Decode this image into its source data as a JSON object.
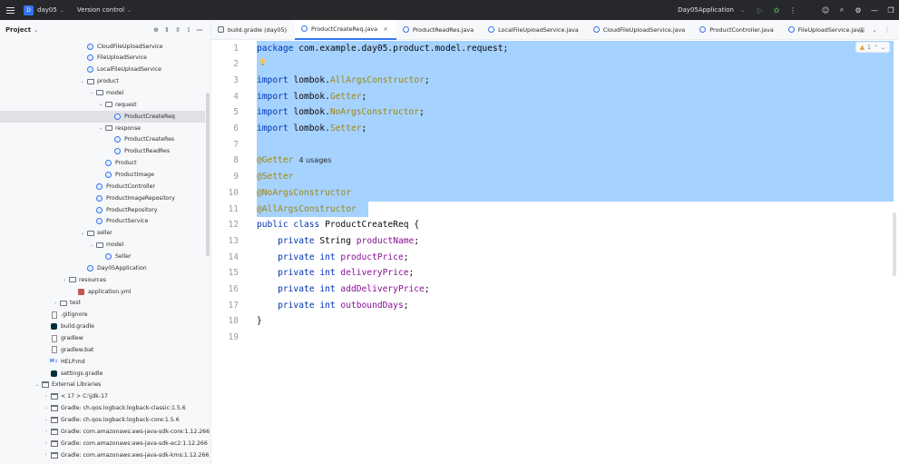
{
  "titlebar": {
    "project_badge": "D",
    "project_name": "day05",
    "version_control": "Version control",
    "run_config": "Day05Application"
  },
  "project_panel": {
    "title": "Project",
    "tree": [
      {
        "label": "CloudFileUploadService",
        "indent": 0,
        "icon": "class-icon"
      },
      {
        "label": "FileUploadService",
        "indent": 0,
        "icon": "class-icon"
      },
      {
        "label": "LocalFileUploadService",
        "indent": 0,
        "icon": "class-icon"
      },
      {
        "label": "product",
        "indent": 0,
        "icon": "folder-icon",
        "arrow": "v"
      },
      {
        "label": "model",
        "indent": 1,
        "icon": "folder-icon",
        "arrow": "v"
      },
      {
        "label": "request",
        "indent": 2,
        "icon": "folder-icon",
        "arrow": "v"
      },
      {
        "label": "ProductCreateReq",
        "indent": 3,
        "icon": "class-icon",
        "selected": true
      },
      {
        "label": "response",
        "indent": 2,
        "icon": "folder-icon",
        "arrow": "v"
      },
      {
        "label": "ProductCreateRes",
        "indent": 3,
        "icon": "class-icon"
      },
      {
        "label": "ProductReadRes",
        "indent": 3,
        "icon": "class-icon"
      },
      {
        "label": "Product",
        "indent": 2,
        "icon": "class-icon"
      },
      {
        "label": "ProductImage",
        "indent": 2,
        "icon": "class-icon"
      },
      {
        "label": "ProductController",
        "indent": 1,
        "icon": "class-icon"
      },
      {
        "label": "ProductImageRepository",
        "indent": 1,
        "icon": "class-icon"
      },
      {
        "label": "ProductRepository",
        "indent": 1,
        "icon": "class-icon"
      },
      {
        "label": "ProductService",
        "indent": 1,
        "icon": "class-icon"
      },
      {
        "label": "seller",
        "indent": 0,
        "icon": "folder-icon",
        "arrow": "v"
      },
      {
        "label": "model",
        "indent": 1,
        "icon": "folder-icon",
        "arrow": "v"
      },
      {
        "label": "Seller",
        "indent": 2,
        "icon": "class-icon"
      },
      {
        "label": "Day05Application",
        "indent": 0,
        "icon": "class-icon"
      },
      {
        "label": "resources",
        "indent": -2,
        "icon": "folder-icon",
        "arrow": "v"
      },
      {
        "label": "application.yml",
        "indent": -1,
        "icon": "yml-icon"
      },
      {
        "label": "test",
        "indent": -3,
        "icon": "folder-icon",
        "arrow": ">"
      },
      {
        "label": ".gitignore",
        "indent": -4,
        "icon": "file-icon"
      },
      {
        "label": "build.gradle",
        "indent": -4,
        "icon": "gradle-icon"
      },
      {
        "label": "gradlew",
        "indent": -4,
        "icon": "file-icon"
      },
      {
        "label": "gradlew.bat",
        "indent": -4,
        "icon": "file-icon"
      },
      {
        "label": "HELP.md",
        "indent": -4,
        "icon": "md-icon"
      },
      {
        "label": "settings.gradle",
        "indent": -4,
        "icon": "gradle-icon"
      },
      {
        "label": "External Libraries",
        "indent": -5,
        "icon": "library-icon",
        "arrow": "v"
      },
      {
        "label": "< 17 >  C:\\jdk-17",
        "indent": -4,
        "icon": "library-icon",
        "arrow": ">"
      },
      {
        "label": "Gradle: ch.qos.logback:logback-classic:1.5.6",
        "indent": -4,
        "icon": "library-icon",
        "arrow": ">"
      },
      {
        "label": "Gradle: ch.qos.logback:logback-core:1.5.6",
        "indent": -4,
        "icon": "library-icon",
        "arrow": ">"
      },
      {
        "label": "Gradle: com.amazonaws:aws-java-sdk-core:1.12.266",
        "indent": -4,
        "icon": "library-icon",
        "arrow": ">"
      },
      {
        "label": "Gradle: com.amazonaws:aws-java-sdk-ec2:1.12.266",
        "indent": -4,
        "icon": "library-icon",
        "arrow": ">"
      },
      {
        "label": "Gradle: com.amazonaws:aws-java-sdk-kms:1.12.266",
        "indent": -4,
        "icon": "library-icon",
        "arrow": ">"
      }
    ]
  },
  "tabs": [
    {
      "label": "build.gradle (day05)",
      "icon": "gradle"
    },
    {
      "label": "ProductCreateReq.java",
      "active": true,
      "close": "×"
    },
    {
      "label": "ProductReadRes.java"
    },
    {
      "label": "LocalFileUploadService.java"
    },
    {
      "label": "CloudFileUploadService.java"
    },
    {
      "label": "ProductController.java"
    },
    {
      "label": "FileUploadService.java"
    }
  ],
  "editor": {
    "inspection_count": "1",
    "lines": [
      {
        "n": "1",
        "parts": [
          [
            "kw",
            "package "
          ],
          [
            "",
            "com.example.day05.product.model.request;"
          ]
        ]
      },
      {
        "n": "2",
        "parts": []
      },
      {
        "n": "3",
        "parts": [
          [
            "kw",
            "import "
          ],
          [
            "",
            "lombok."
          ],
          [
            "ann",
            "AllArgsConstructor"
          ],
          [
            "",
            ";"
          ]
        ]
      },
      {
        "n": "4",
        "parts": [
          [
            "kw",
            "import "
          ],
          [
            "",
            "lombok."
          ],
          [
            "ann",
            "Getter"
          ],
          [
            "",
            ";"
          ]
        ]
      },
      {
        "n": "5",
        "parts": [
          [
            "kw",
            "import "
          ],
          [
            "",
            "lombok."
          ],
          [
            "ann",
            "NoArgsConstructor"
          ],
          [
            "",
            ";"
          ]
        ]
      },
      {
        "n": "6",
        "parts": [
          [
            "kw",
            "import "
          ],
          [
            "",
            "lombok."
          ],
          [
            "ann",
            "Setter"
          ],
          [
            "",
            ";"
          ]
        ]
      },
      {
        "n": "7",
        "parts": []
      },
      {
        "n": "8",
        "parts": [
          [
            "ann",
            "@Getter"
          ]
        ],
        "usage": "4 usages"
      },
      {
        "n": "9",
        "parts": [
          [
            "ann",
            "@Setter"
          ]
        ]
      },
      {
        "n": "10",
        "parts": [
          [
            "ann",
            "@NoArgsConstructor"
          ]
        ]
      },
      {
        "n": "11",
        "parts": [
          [
            "ann",
            "@AllArgsConstructor"
          ]
        ]
      },
      {
        "n": "12",
        "parts": [
          [
            "kw",
            "public class "
          ],
          [
            "",
            "ProductCreateReq {"
          ]
        ]
      },
      {
        "n": "13",
        "parts": [
          [
            "",
            "    "
          ],
          [
            "kw",
            "private "
          ],
          [
            "",
            "String "
          ],
          [
            "fld",
            "productName"
          ],
          [
            "",
            ";"
          ]
        ]
      },
      {
        "n": "14",
        "parts": [
          [
            "",
            "    "
          ],
          [
            "kw",
            "private int "
          ],
          [
            "fld",
            "productPrice"
          ],
          [
            "",
            ";"
          ]
        ]
      },
      {
        "n": "15",
        "parts": [
          [
            "",
            "    "
          ],
          [
            "kw",
            "private int "
          ],
          [
            "fld",
            "deliveryPrice"
          ],
          [
            "",
            ";"
          ]
        ]
      },
      {
        "n": "16",
        "parts": [
          [
            "",
            "    "
          ],
          [
            "kw",
            "private int "
          ],
          [
            "fld",
            "addDeliveryPrice"
          ],
          [
            "",
            ";"
          ]
        ]
      },
      {
        "n": "17",
        "parts": [
          [
            "",
            "    "
          ],
          [
            "kw",
            "private int "
          ],
          [
            "fld",
            "outboundDays"
          ],
          [
            "",
            ";"
          ]
        ]
      },
      {
        "n": "18",
        "parts": [
          [
            "",
            "}"
          ]
        ]
      },
      {
        "n": "19",
        "parts": []
      }
    ]
  }
}
